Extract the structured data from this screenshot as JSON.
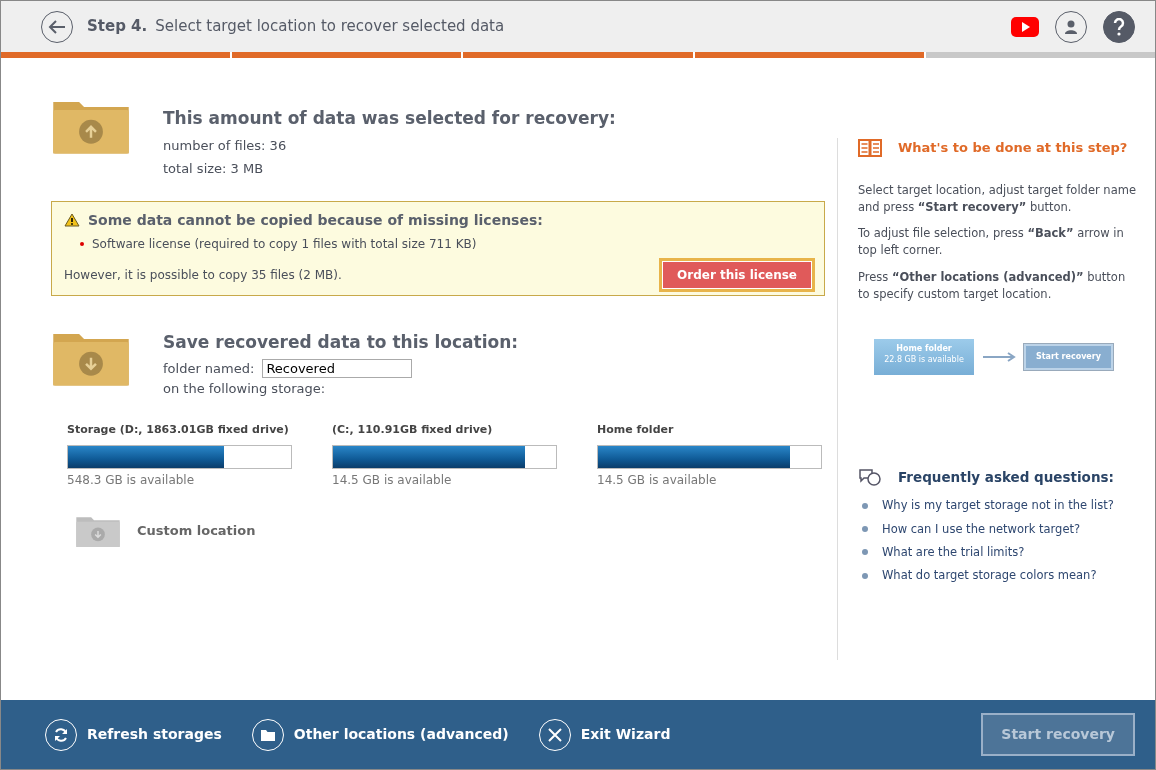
{
  "header": {
    "step": "Step 4.",
    "title": "Select target location to recover selected data"
  },
  "progress": [
    {
      "done": true
    },
    {
      "done": true
    },
    {
      "done": true
    },
    {
      "done": true
    },
    {
      "done": false
    }
  ],
  "selection": {
    "heading": "This amount of data was selected for recovery:",
    "lines": [
      "number of files: 36",
      "total size: 3 MB"
    ]
  },
  "warning": {
    "heading": "Some data cannot be copied because of missing licenses:",
    "items": [
      "Software license (required to copy 1 files with total size 711 KB)"
    ],
    "note": "However, it is possible to copy 35 files (2 MB).",
    "button": "Order this license"
  },
  "target": {
    "heading": "Save recovered data to this location:",
    "folder_label": "folder named:",
    "folder_value": "Recovered",
    "storage_label": "on the following storage:"
  },
  "storages": [
    {
      "name": "Storage (D:, 1863.01GB fixed drive)",
      "level": 0.7,
      "available": "548.3 GB is available"
    },
    {
      "name": "(C:, 110.91GB fixed drive)",
      "level": 0.86,
      "available": "14.5 GB is available"
    },
    {
      "name": "Home folder",
      "level": 0.86,
      "available": "14.5 GB is available"
    }
  ],
  "custom_location": "Custom location",
  "help": {
    "heading": "What's to be done at this step?",
    "paragraphs": [
      "Select target location, adjust target folder name and press **“Start recovery”** button.",
      "To adjust file selection, press **“Back”** arrow in top left corner.",
      "Press **“Other locations (advanced)”** button to specify custom target location."
    ],
    "illustration": {
      "tile_title": "Home folder",
      "tile_sub": "22.8 GB is available",
      "button": "Start recovery"
    }
  },
  "faq": {
    "heading": "Frequently asked questions:",
    "items": [
      "Why is my target storage not in the list?",
      "How can I use the network target?",
      "What are the trial limits?",
      "What do target storage colors mean?"
    ]
  },
  "footer": {
    "actions": [
      {
        "kind": "refresh",
        "label": "Refresh storages"
      },
      {
        "kind": "folder",
        "label": "Other locations (advanced)"
      },
      {
        "kind": "exit",
        "label": "Exit Wizard"
      }
    ],
    "start": {
      "label": "Start recovery",
      "disabled": true
    }
  }
}
